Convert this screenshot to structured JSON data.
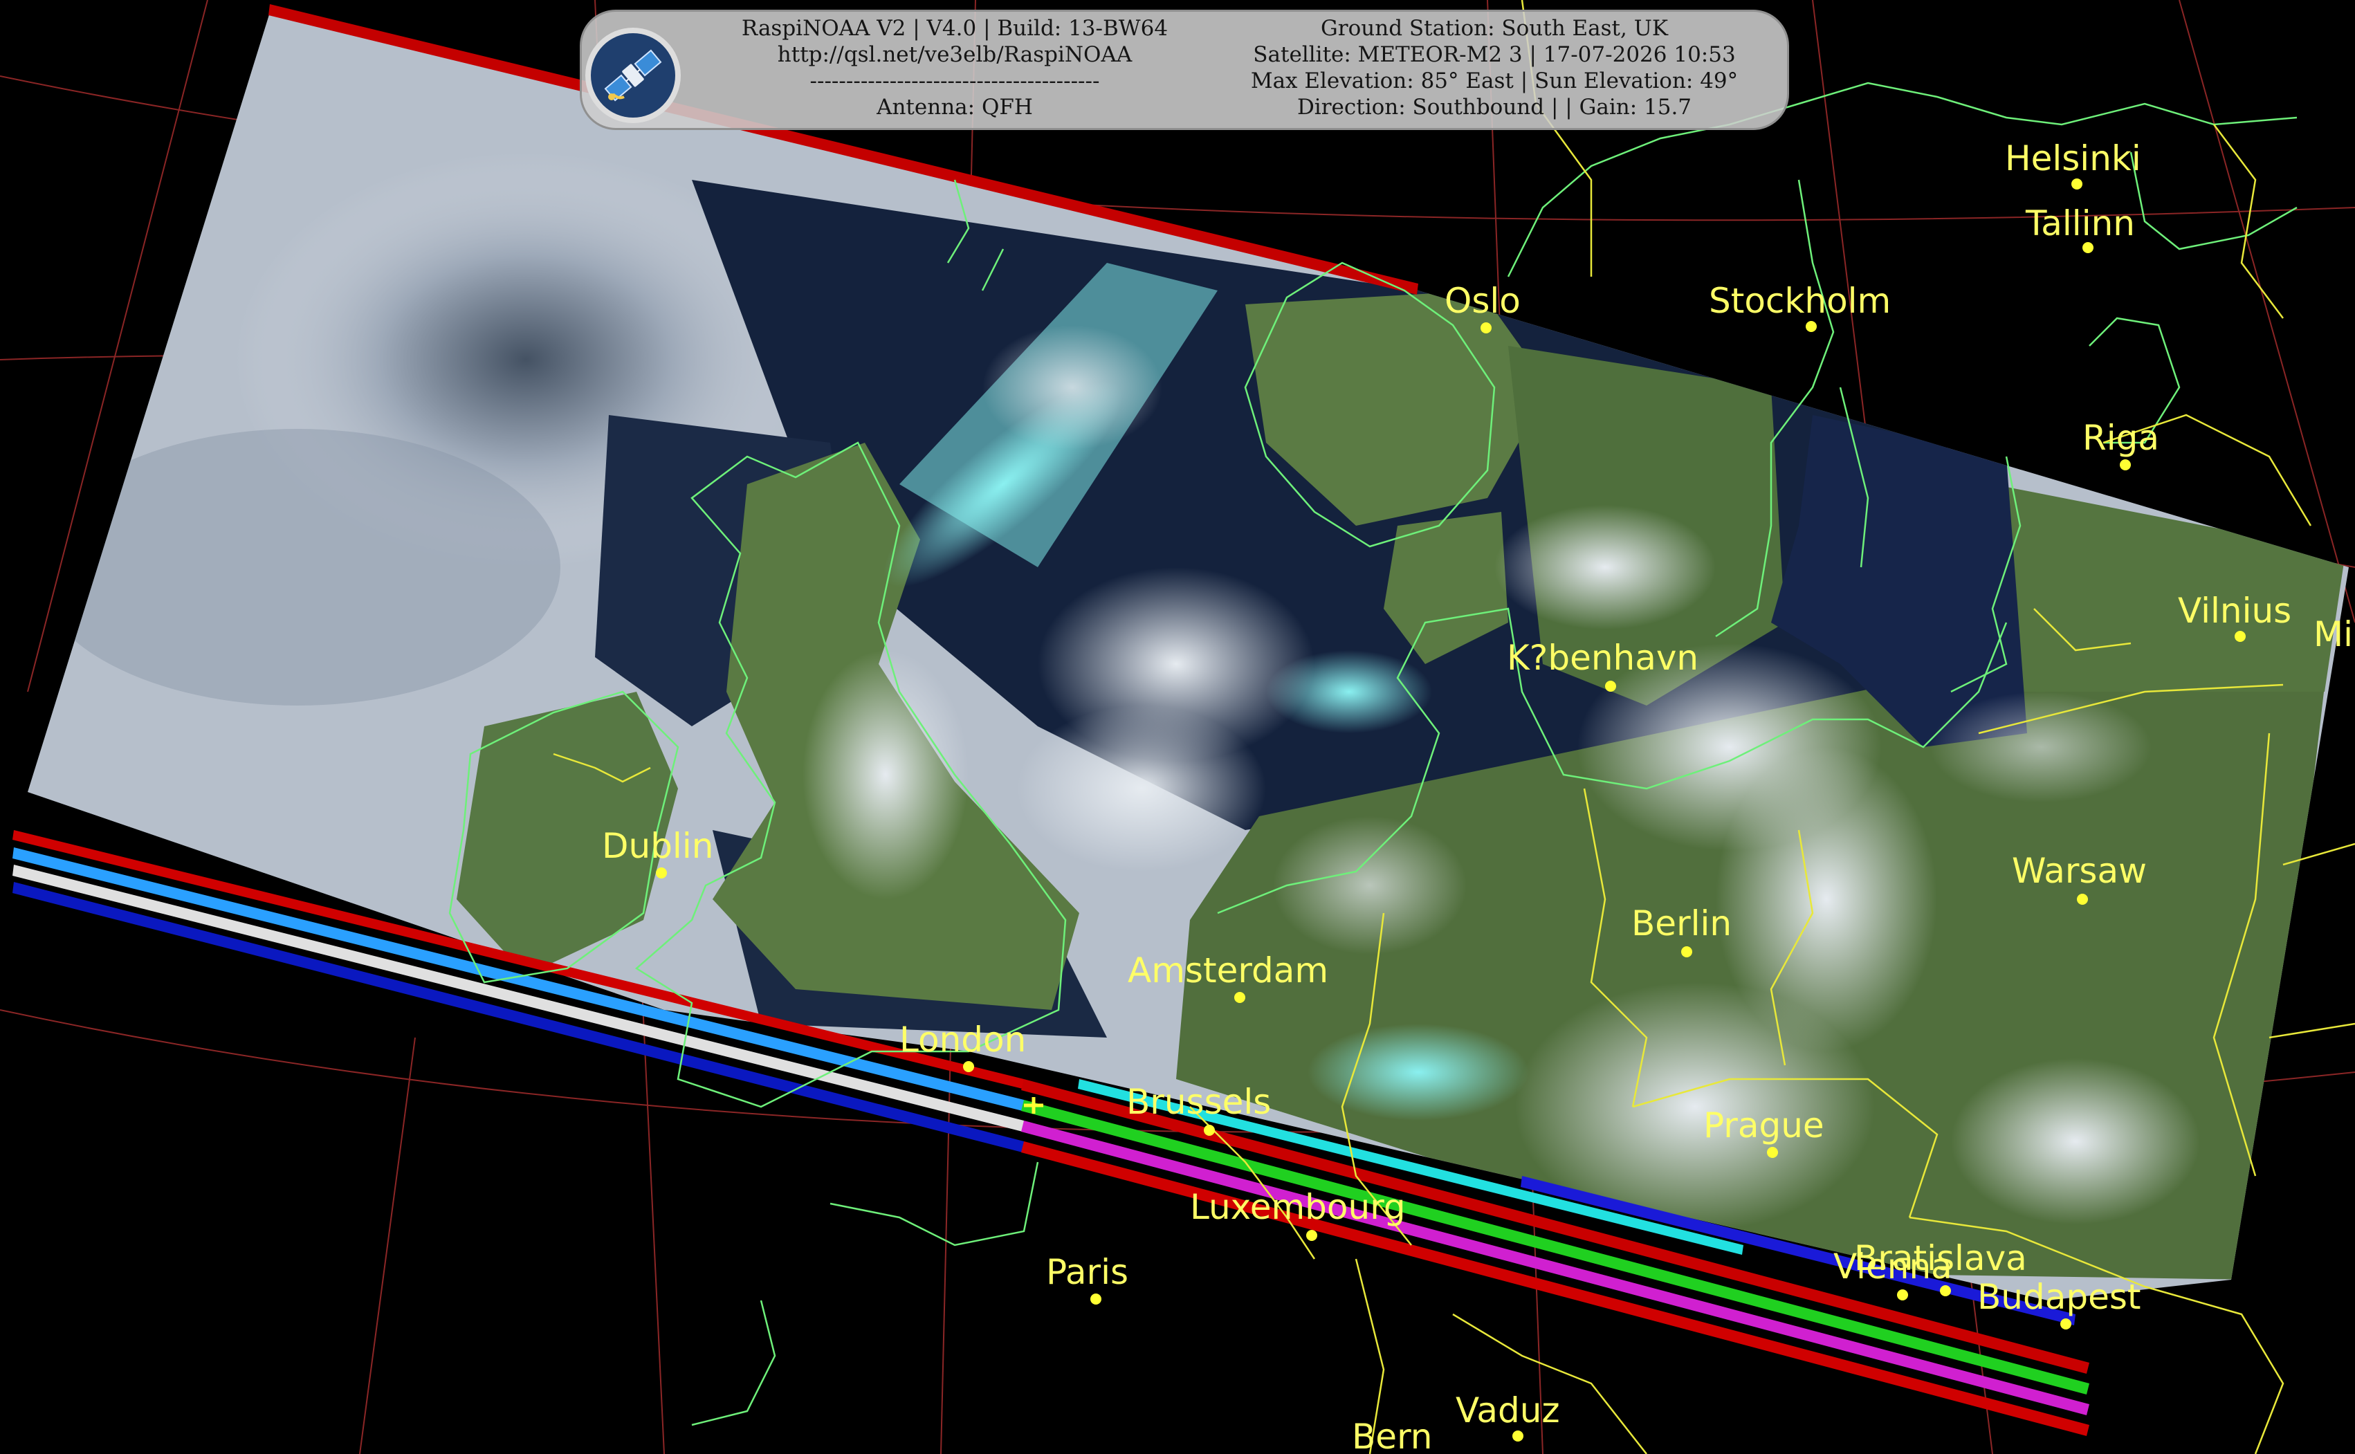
{
  "header": {
    "left_lines": [
      "RaspiNOAA V2 | V4.0 | Build: 13-BW64",
      "http://qsl.net/ve3elb/RaspiNOAA",
      "----------------------------------------",
      "Antenna: QFH"
    ],
    "right_lines": [
      "Ground Station: South East, UK",
      "Satellite: METEOR-M2 3 | 17-07-2026 10:53",
      "Max Elevation: 85° East | Sun Elevation: 49°",
      "Direction: Southbound | | Gain: 15.7"
    ],
    "logo_icon": "satellite-icon"
  },
  "cities": [
    {
      "name": "Oslo"
    },
    {
      "name": "Stockholm"
    },
    {
      "name": "Helsinki"
    },
    {
      "name": "Tallinn"
    },
    {
      "name": "Riga"
    },
    {
      "name": "Vilnius"
    },
    {
      "name": "Mi"
    },
    {
      "name": "K?benhavn"
    },
    {
      "name": "Dublin"
    },
    {
      "name": "Warsaw"
    },
    {
      "name": "Berlin"
    },
    {
      "name": "Amsterdam"
    },
    {
      "name": "London"
    },
    {
      "name": "Brussels"
    },
    {
      "name": "Prague"
    },
    {
      "name": "Luxembourg"
    },
    {
      "name": "Paris"
    },
    {
      "name": "Vienna"
    },
    {
      "name": "Bratislava"
    },
    {
      "name": "Budapest"
    },
    {
      "name": "Vaduz"
    },
    {
      "name": "Bern"
    }
  ],
  "colors": {
    "background": "#000000",
    "city_label": "#ffff66",
    "coastline": "#6ef07a",
    "border": "#e8e83a",
    "graticule": "#9a2a2a",
    "sea": "#0f1e38",
    "land": "#4f6f3c",
    "cloud": "#c9cfd8",
    "cloud_cyan": "#7ee8e8"
  }
}
